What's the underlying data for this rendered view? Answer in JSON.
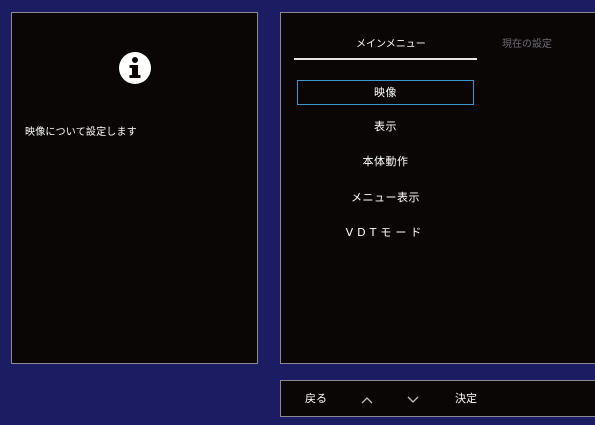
{
  "info": {
    "icon": "info-icon",
    "description": "映像について設定します"
  },
  "tabs": {
    "main": "メインメニュー",
    "current": "現在の設定"
  },
  "menu": {
    "items": [
      "映像",
      "表示",
      "本体動作",
      "メニュー表示",
      "VDTモード"
    ],
    "selected_index": 0
  },
  "buttons": {
    "back": "戻る",
    "up_icon": "chevron-up-icon",
    "down_icon": "chevron-down-icon",
    "ok": "決定"
  },
  "colors": {
    "background": "#1c1c63",
    "panel": "#0a0606",
    "selection_border": "#3a98cf",
    "inactive_tab": "#6b6b72"
  }
}
